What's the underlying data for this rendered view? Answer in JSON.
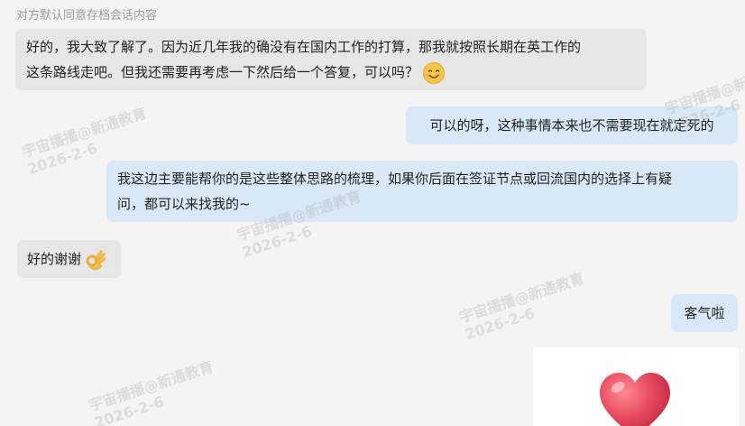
{
  "chat": {
    "notice": "对方默认同意存档会话内容",
    "messages": [
      {
        "side": "left",
        "lines": [
          "好的，我大致了解了。因为近几年我的确没有在国内工作的打算，那我就按照长期在英工作的",
          "这条路线走吧。但我还需要再考虑一下然后给一个答复，可以吗？"
        ],
        "emoji": "smiling-face-icon"
      },
      {
        "side": "right",
        "lines": [
          "可以的呀，这种事情本来也不需要现在就定死的"
        ]
      },
      {
        "side": "right",
        "lines": [
          "我这边主要能帮你的是这些整体思路的梳理，如果你后面在签证节点或回流国内的选择上有疑",
          "问，都可以来找我的~"
        ]
      },
      {
        "side": "left",
        "lines": [
          "好的谢谢"
        ],
        "emoji": "ok-hand-icon"
      },
      {
        "side": "right",
        "lines": [
          "客气啦"
        ]
      }
    ],
    "sticker": {
      "icon": "heart-sticker-icon",
      "color": "#e84a5f"
    }
  },
  "watermark": {
    "text_cn": "宇宙播播@新通教育",
    "date": "2026-2-6"
  },
  "colors": {
    "background": "#f4f4f4",
    "left_bubble": "#e6e6e6",
    "right_bubble": "#d8e8f7",
    "notice_text": "#9a9a9a"
  }
}
